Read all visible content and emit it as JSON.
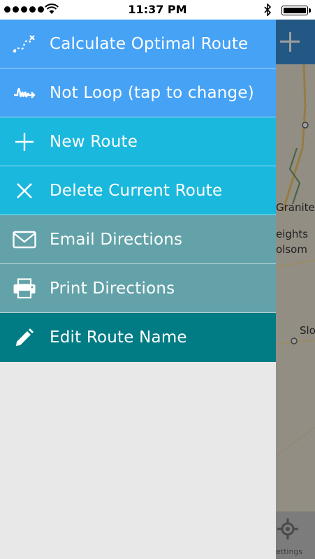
{
  "status_bar": {
    "time": "11:37 PM"
  },
  "menu": {
    "items": [
      {
        "label": "Calculate Optimal Route",
        "icon": "route-icon",
        "color": "#45a2f5"
      },
      {
        "label": "Not Loop (tap to change)",
        "icon": "loop-icon",
        "color": "#45a2f5"
      },
      {
        "label": "New Route",
        "icon": "plus-icon",
        "color": "#1bb8dd"
      },
      {
        "label": "Delete Current Route",
        "icon": "close-icon",
        "color": "#1bb8dd"
      },
      {
        "label": "Email Directions",
        "icon": "envelope-icon",
        "color": "#63a2a9"
      },
      {
        "label": "Print Directions",
        "icon": "printer-icon",
        "color": "#63a2a9"
      },
      {
        "label": "Edit Route Name",
        "icon": "pencil-icon",
        "color": "#027c84"
      }
    ]
  },
  "map": {
    "labels": [
      "Granite",
      "eights",
      "olsom",
      "Slo"
    ],
    "settings_label": "ettings"
  }
}
